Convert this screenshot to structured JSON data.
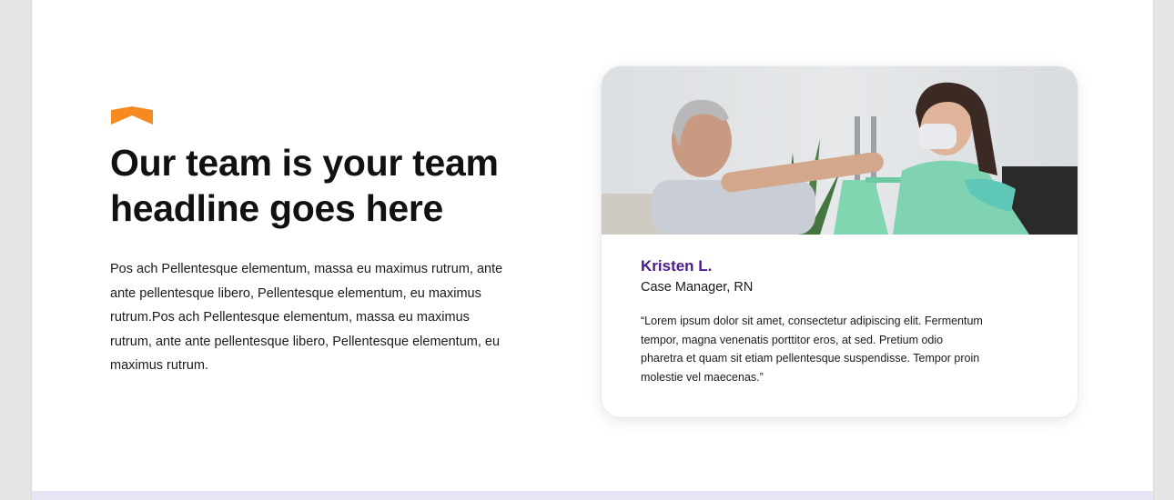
{
  "section": {
    "headline": "Our team is your team headline goes here",
    "body": "Pos ach Pellentesque elementum, massa eu maximus rutrum, ante ante pellentesque libero, Pellentesque elementum,  eu maximus rutrum.Pos ach Pellentesque elementum, massa eu maximus rutrum, ante ante pellentesque libero, Pellentesque elementum,  eu maximus rutrum."
  },
  "testimonial": {
    "name": "Kristen L.",
    "role": "Case Manager, RN",
    "quote": "“Lorem ipsum dolor sit amet, consectetur adipiscing elit. Fermentum tempor, magna venenatis porttitor eros, at sed. Pretium odio pharetra et quam sit etiam pellentesque suspendisse. Tempor proin molestie vel maecenas.”"
  },
  "colors": {
    "accent": "#f6891f",
    "name_purple": "#4b1a8c",
    "band": "#e7e4f6"
  }
}
